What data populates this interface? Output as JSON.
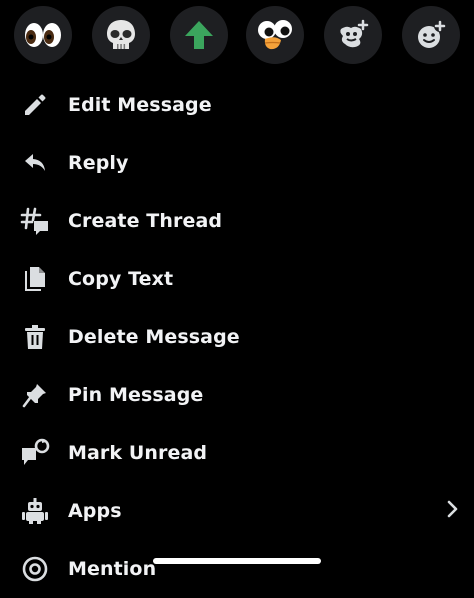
{
  "reactions": [
    {
      "name": "eyes-emoji",
      "emoji": "👀"
    },
    {
      "name": "skull-emoji",
      "emoji": "💀"
    },
    {
      "name": "upvote-arrow-emoji",
      "emoji": "⬆"
    },
    {
      "name": "duck-eyes-emoji",
      "emoji": "custom"
    },
    {
      "name": "add-super-reaction-icon",
      "emoji": ""
    },
    {
      "name": "add-reaction-icon",
      "emoji": ""
    }
  ],
  "menu": {
    "items": [
      {
        "label": "Edit Message",
        "icon": "pencil-icon"
      },
      {
        "label": "Reply",
        "icon": "reply-arrow-icon"
      },
      {
        "label": "Create Thread",
        "icon": "thread-icon"
      },
      {
        "label": "Copy Text",
        "icon": "copy-icon"
      },
      {
        "label": "Delete Message",
        "icon": "trash-icon"
      },
      {
        "label": "Pin Message",
        "icon": "pin-icon"
      },
      {
        "label": "Mark Unread",
        "icon": "mark-unread-icon"
      },
      {
        "label": "Apps",
        "icon": "robot-icon"
      },
      {
        "label": "Mention",
        "icon": "at-icon"
      }
    ]
  },
  "colors": {
    "background": "#000000",
    "reaction_bg": "#1e1f22",
    "text": "#f2f3f5",
    "icon": "#dbdee1",
    "green_arrow": "#3ba55d"
  }
}
